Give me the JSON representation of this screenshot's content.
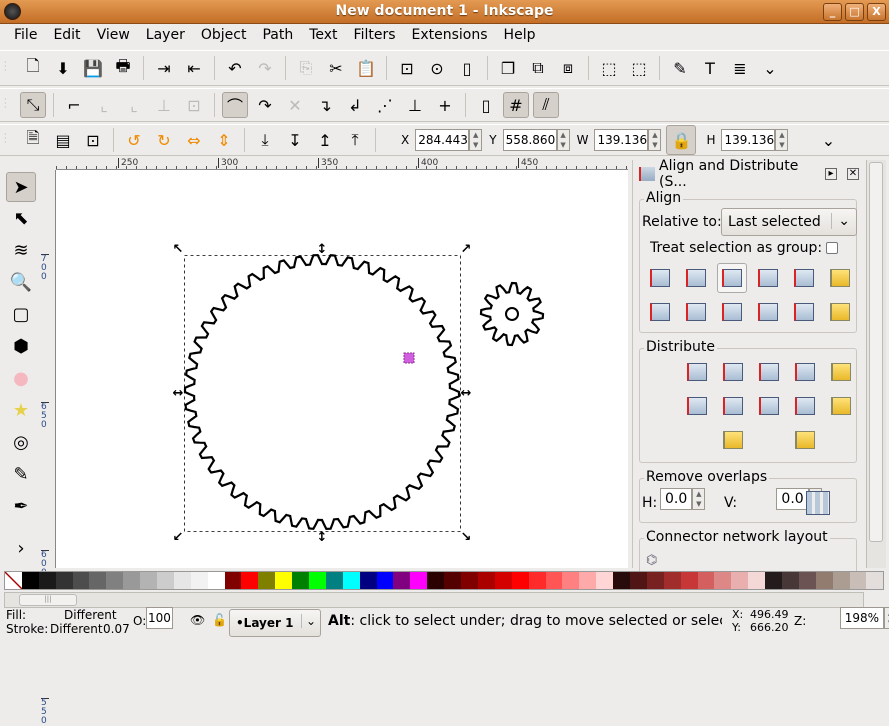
{
  "window": {
    "title": "New document 1 - Inkscape",
    "controls": [
      "_",
      "□",
      "X"
    ]
  },
  "menu": [
    "File",
    "Edit",
    "View",
    "Layer",
    "Object",
    "Path",
    "Text",
    "Filters",
    "Extensions",
    "Help"
  ],
  "toolbar_commands": [
    {
      "icon": "new-document-icon",
      "g": "🗋"
    },
    {
      "icon": "open-icon",
      "g": "⬇"
    },
    {
      "icon": "save-icon",
      "g": "💾"
    },
    {
      "icon": "print-icon",
      "g": "🖶"
    },
    null,
    {
      "icon": "import-icon",
      "g": "⇥"
    },
    {
      "icon": "export-icon",
      "g": "⇤"
    },
    null,
    {
      "icon": "undo-icon",
      "g": "↶"
    },
    {
      "icon": "redo-icon",
      "g": "↷",
      "dim": true
    },
    null,
    {
      "icon": "copy-icon",
      "g": "⎘",
      "dim": true
    },
    {
      "icon": "cut-icon",
      "g": "✂"
    },
    {
      "icon": "paste-icon",
      "g": "📋"
    },
    null,
    {
      "icon": "zoom-selection-icon",
      "g": "⊡"
    },
    {
      "icon": "zoom-drawing-icon",
      "g": "⊙"
    },
    {
      "icon": "zoom-page-icon",
      "g": "▯"
    },
    null,
    {
      "icon": "duplicate-icon",
      "g": "❐"
    },
    {
      "icon": "clone-icon",
      "g": "⧉"
    },
    {
      "icon": "unlink-clone-icon",
      "g": "⧈"
    },
    null,
    {
      "icon": "group-icon",
      "g": "⬚"
    },
    {
      "icon": "ungroup-icon",
      "g": "⬚"
    },
    null,
    {
      "icon": "fill-stroke-icon",
      "g": "✎"
    },
    {
      "icon": "text-font-icon",
      "g": "T"
    },
    {
      "icon": "layers-icon",
      "g": "≣"
    },
    {
      "icon": "more-chevron-icon",
      "g": "⌄"
    }
  ],
  "toolbar_snap": [
    {
      "icon": "snap-toggle-icon",
      "g": "⤡",
      "on": true
    },
    null,
    {
      "icon": "snap-bbox-icon",
      "g": "⌐"
    },
    {
      "icon": "snap-bbox-edge-icon",
      "g": "⌞",
      "dim": true
    },
    {
      "icon": "snap-bbox-corner-icon",
      "g": "⌞",
      "dim": true
    },
    {
      "icon": "snap-bbox-midpoint-icon",
      "g": "⊥",
      "dim": true
    },
    {
      "icon": "snap-bbox-center-icon",
      "g": "⊡",
      "dim": true
    },
    null,
    {
      "icon": "snap-nodes-icon",
      "g": "⌒",
      "on": true
    },
    {
      "icon": "snap-paths-icon",
      "g": "↷"
    },
    {
      "icon": "snap-intersections-icon",
      "g": "✕",
      "dim": true
    },
    {
      "icon": "snap-smooth-nodes-icon",
      "g": "↴"
    },
    {
      "icon": "snap-midpoints-icon",
      "g": "↲"
    },
    {
      "icon": "snap-object-centers-icon",
      "g": "⋰"
    },
    {
      "icon": "snap-rotation-center-icon",
      "g": "⊥"
    },
    {
      "icon": "snap-text-baseline-icon",
      "g": "+"
    },
    null,
    {
      "icon": "snap-page-border-icon",
      "g": "▯"
    },
    {
      "icon": "snap-grid-icon",
      "g": "#",
      "on": true
    },
    {
      "icon": "snap-guides-icon",
      "g": "⫽",
      "on": true
    }
  ],
  "toolbar_select": {
    "icons": [
      {
        "icon": "select-all-icon",
        "g": "🗎"
      },
      {
        "icon": "select-all-layers-icon",
        "g": "▤"
      },
      {
        "icon": "deselect-icon",
        "g": "⊡"
      },
      null,
      {
        "icon": "rotate-ccw-icon",
        "g": "↺",
        "c": "#f08a00"
      },
      {
        "icon": "rotate-cw-icon",
        "g": "↻",
        "c": "#f08a00"
      },
      {
        "icon": "flip-horizontal-icon",
        "g": "⇔",
        "c": "#f08a00"
      },
      {
        "icon": "flip-vertical-icon",
        "g": "⇕",
        "c": "#f08a00"
      },
      null,
      {
        "icon": "lower-to-bottom-icon",
        "g": "⤓"
      },
      {
        "icon": "lower-icon",
        "g": "↧"
      },
      {
        "icon": "raise-icon",
        "g": "↥"
      },
      {
        "icon": "raise-to-top-icon",
        "g": "⤒"
      }
    ],
    "x_label": "X",
    "x": "284.443",
    "y_label": "Y",
    "y": "558.860",
    "w_label": "W",
    "w": "139.136",
    "h_label": "H",
    "h": "139.136",
    "lock_icon": "lock-icon"
  },
  "rulers": {
    "top": [
      "250",
      "300",
      "350",
      "400",
      "450"
    ],
    "left": [
      "700",
      "650",
      "600",
      "550"
    ]
  },
  "tools": [
    {
      "icon": "selector-arrow-icon",
      "g": "➤",
      "on": true
    },
    {
      "icon": "node-editor-icon",
      "g": "⬉"
    },
    {
      "icon": "tweak-icon",
      "g": "≋"
    },
    {
      "icon": "zoom-icon",
      "g": "🔍"
    },
    {
      "icon": "rectangle-icon",
      "g": "▢"
    },
    {
      "icon": "3d-box-icon",
      "g": "⬢"
    },
    {
      "icon": "ellipse-icon",
      "g": "●",
      "c": "#f6b8c0"
    },
    {
      "icon": "star-icon",
      "g": "★",
      "c": "#e6d24a"
    },
    {
      "icon": "spiral-icon",
      "g": "◎"
    },
    {
      "icon": "pencil-icon",
      "g": "✎"
    },
    {
      "icon": "pen-bezier-icon",
      "g": "✒"
    },
    {
      "icon": "expand-chevron-icon",
      "g": "›"
    }
  ],
  "panel": {
    "title": "Align and Distribute (S...",
    "align_title": "Align",
    "relative_label": "Relative to:",
    "relative_value": "Last selected",
    "group_label": "Treat selection as group:",
    "group_checked": false,
    "align_buttons": [
      "align-right-edges-to-left-anchor-icon",
      "align-left-edges-icon",
      "center-on-vertical-axis-icon",
      "align-right-edges-icon",
      "align-left-edges-to-right-anchor-icon",
      "align-text-baselines-vertical-icon",
      "align-bottom-to-top-anchor-icon",
      "align-top-edges-icon",
      "center-on-horizontal-axis-icon",
      "align-bottom-edges-icon",
      "align-top-to-bottom-anchor-icon",
      "align-text-baselines-horizontal-icon"
    ],
    "distribute_title": "Distribute",
    "distribute_buttons": [
      "distribute-left-edges-icon",
      "distribute-centers-horizontal-icon",
      "distribute-right-edges-icon",
      "distribute-gaps-horizontal-icon",
      "distribute-text-baselines-horizontal-icon",
      "distribute-top-edges-icon",
      "distribute-centers-vertical-icon",
      "distribute-bottom-edges-icon",
      "distribute-gaps-vertical-icon",
      "distribute-text-baselines-vertical-icon",
      "randomize-positions-icon",
      "unclump-icon"
    ],
    "overlaps_title": "Remove overlaps",
    "h_label": "H:",
    "h_value": "0.0",
    "v_label": "V:",
    "v_value": "0.0",
    "remove_overlaps_icon": "remove-overlaps-icon",
    "connector_title": "Connector network layout"
  },
  "palette": [
    "#000000",
    "#1a1a1a",
    "#333333",
    "#4d4d4d",
    "#666666",
    "#808080",
    "#999999",
    "#b3b3b3",
    "#cccccc",
    "#e6e6e6",
    "#f2f2f2",
    "#ffffff",
    "#800000",
    "#ff0000",
    "#808000",
    "#ffff00",
    "#008000",
    "#00ff00",
    "#008080",
    "#00ffff",
    "#000080",
    "#0000ff",
    "#800080",
    "#ff00ff",
    "#2b0000",
    "#550000",
    "#800000",
    "#aa0000",
    "#d40000",
    "#ff0000",
    "#ff2a2a",
    "#ff5555",
    "#ff8080",
    "#ffaaaa",
    "#ffd5d5",
    "#280b0b",
    "#501616",
    "#782121",
    "#a02c2c",
    "#c83737",
    "#d35f5f",
    "#de8787",
    "#e9afaf",
    "#f4d7d7",
    "#241c1c",
    "#483737",
    "#6c5353",
    "#917c6f",
    "#ac9d93",
    "#c8beb7",
    "#e3dedb"
  ],
  "status": {
    "fill_label": "Fill:",
    "fill_value": "Different",
    "stroke_label": "Stroke:",
    "stroke_value": "Different",
    "stroke_width": "0.07",
    "opacity_label": "O:",
    "opacity_value": "100",
    "layer": "•Layer 1",
    "message_bold": "Alt",
    "message": ": click to select under; drag to move selected or select by",
    "x_label": "X:",
    "x": "496.49",
    "y_label": "Y:",
    "y": "666.20",
    "zoom_label": "Z:",
    "zoom": "198%"
  },
  "drawing": {
    "large_gear_teeth": 50,
    "small_gear_teeth": 12,
    "accent": "#d060e0"
  }
}
